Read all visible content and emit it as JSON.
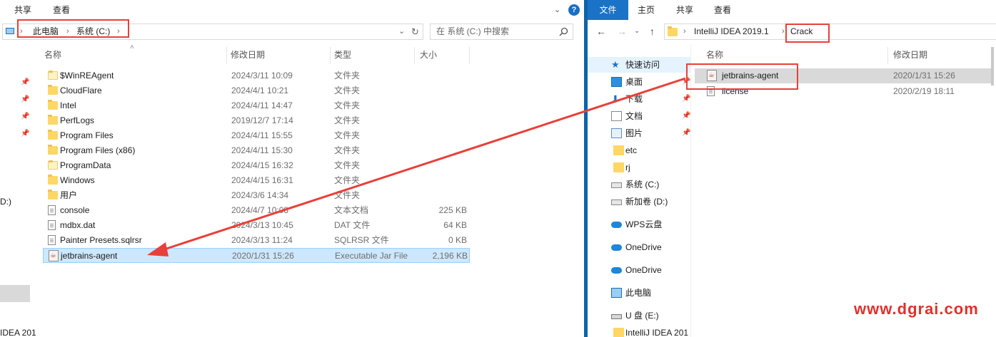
{
  "left": {
    "ribbon": {
      "tab_share": "共享",
      "tab_view": "查看"
    },
    "address": {
      "crumbs": [
        "此电脑",
        "系统 (C:)"
      ]
    },
    "search": {
      "placeholder": "在 系统 (C:) 中搜索"
    },
    "columns": {
      "name": "名称",
      "date": "修改日期",
      "type": "类型",
      "size": "大小"
    },
    "files": [
      {
        "name": "$WinREAgent",
        "date": "2024/3/11 10:09",
        "type": "文件夹",
        "size": ""
      },
      {
        "name": "CloudFlare",
        "date": "2024/4/1 10:21",
        "type": "文件夹",
        "size": ""
      },
      {
        "name": "Intel",
        "date": "2024/4/11 14:47",
        "type": "文件夹",
        "size": ""
      },
      {
        "name": "PerfLogs",
        "date": "2019/12/7 17:14",
        "type": "文件夹",
        "size": ""
      },
      {
        "name": "Program Files",
        "date": "2024/4/11 15:55",
        "type": "文件夹",
        "size": ""
      },
      {
        "name": "Program Files (x86)",
        "date": "2024/4/11 15:30",
        "type": "文件夹",
        "size": ""
      },
      {
        "name": "ProgramData",
        "date": "2024/4/15 16:32",
        "type": "文件夹",
        "size": ""
      },
      {
        "name": "Windows",
        "date": "2024/4/15 16:31",
        "type": "文件夹",
        "size": ""
      },
      {
        "name": "用户",
        "date": "2024/3/6 14:34",
        "type": "文件夹",
        "size": ""
      },
      {
        "name": "console",
        "date": "2024/4/7 10:08",
        "type": "文本文档",
        "size": "225 KB"
      },
      {
        "name": "mdbx.dat",
        "date": "2024/3/13 10:45",
        "type": "DAT 文件",
        "size": "64 KB"
      },
      {
        "name": "Painter Presets.sqlrsr",
        "date": "2024/3/13 11:24",
        "type": "SQLRSR 文件",
        "size": "0 KB"
      },
      {
        "name": "jetbrains-agent",
        "date": "2020/1/31 15:26",
        "type": "Executable Jar File",
        "size": "2,196 KB"
      }
    ],
    "nav_fragments": {
      "drive_frag": "D:)",
      "idea_frag": "IDEA 201"
    }
  },
  "right": {
    "ribbon": {
      "tab_file": "文件",
      "tab_home": "主页",
      "tab_share": "共享",
      "tab_view": "查看"
    },
    "address": {
      "crumbs": [
        "IntelliJ IDEA 2019.1",
        "Crack"
      ]
    },
    "columns": {
      "name": "名称",
      "date": "修改日期"
    },
    "files": [
      {
        "name": "jetbrains-agent",
        "date": "2020/1/31 15:26"
      },
      {
        "name": "license",
        "date": "2020/2/19 18:11"
      }
    ],
    "nav": [
      {
        "label": "快速访问",
        "icon": "star-icon"
      },
      {
        "label": "桌面",
        "icon": "desktop-icon"
      },
      {
        "label": "下载",
        "icon": "download-icon"
      },
      {
        "label": "文档",
        "icon": "document-icon"
      },
      {
        "label": "图片",
        "icon": "picture-icon"
      },
      {
        "label": "etc",
        "icon": "folder-icon"
      },
      {
        "label": "rj",
        "icon": "folder-icon"
      },
      {
        "label": "系统 (C:)",
        "icon": "drive-icon"
      },
      {
        "label": "新加卷 (D:)",
        "icon": "drive-icon"
      },
      {
        "label": "WPS云盘",
        "icon": "cloud-icon"
      },
      {
        "label": "OneDrive",
        "icon": "cloud-icon"
      },
      {
        "label": "OneDrive",
        "icon": "cloud-icon"
      },
      {
        "label": "此电脑",
        "icon": "computer-icon"
      },
      {
        "label": "U 盘 (E:)",
        "icon": "usb-drive-icon"
      },
      {
        "label": "IntelliJ IDEA 201",
        "icon": "folder-icon"
      }
    ]
  },
  "watermark": "www.dgrai.com",
  "colors": {
    "accent": "#1a73c7",
    "highlight": "#e8403a",
    "selection": "#cce8ff"
  }
}
